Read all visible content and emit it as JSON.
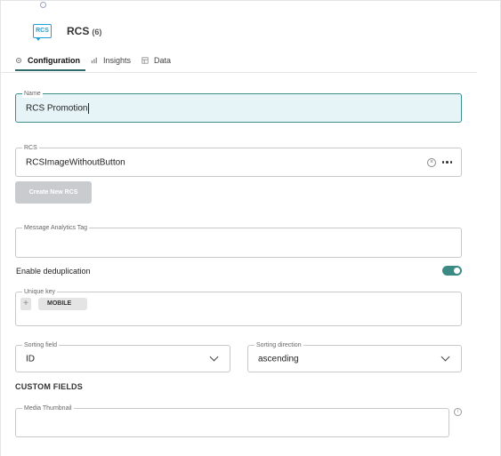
{
  "header": {
    "title": "RCS",
    "count": "(6)",
    "logo_text": "RCS"
  },
  "tabs": [
    {
      "label": "Configuration",
      "icon": "gear-icon",
      "active": true
    },
    {
      "label": "Insights",
      "icon": "bar-chart-icon",
      "active": false
    },
    {
      "label": "Data",
      "icon": "data-icon",
      "active": false
    }
  ],
  "form": {
    "name": {
      "legend": "Name",
      "value": "RCS Promotion"
    },
    "rcs": {
      "legend": "RCS",
      "value": "RCSImageWithoutButton"
    },
    "create_button": "Create New RCS",
    "analytics_tag": {
      "legend": "Message Analytics Tag",
      "value": ""
    },
    "deduplication": {
      "label": "Enable deduplication",
      "enabled": true
    },
    "unique_key": {
      "legend": "Unique key",
      "chips": [
        "MOBILE"
      ],
      "add_symbol": "+"
    },
    "sorting_field": {
      "legend": "Sorting field",
      "value": "ID"
    },
    "sorting_direction": {
      "legend": "Sorting direction",
      "value": "ascending"
    },
    "custom_fields_title": "CUSTOM FIELDS",
    "media_thumbnail": {
      "legend": "Media Thumbnail",
      "value": ""
    }
  },
  "colors": {
    "accent": "#3b8a84",
    "focus_bg": "#e6f3f7",
    "logo": "#1e9fd6",
    "button_disabled": "#c9cccf"
  }
}
